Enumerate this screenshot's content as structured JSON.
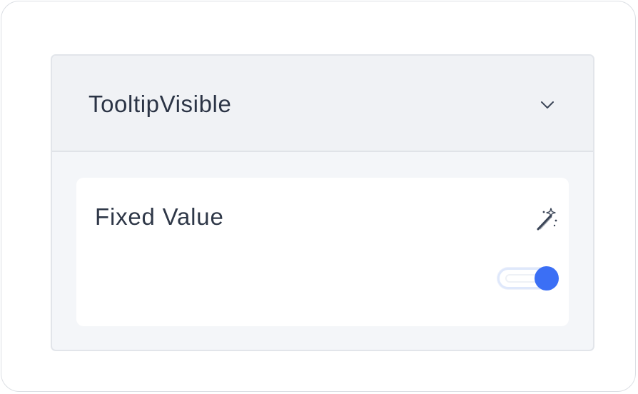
{
  "panel": {
    "title": "TooltipVisible",
    "collapse_icon": "chevron-down-icon"
  },
  "property": {
    "label": "Fixed Value",
    "action_icon": "magic-wand-icon",
    "toggle": {
      "checked": true,
      "accent_color": "#3b6ff5"
    }
  }
}
